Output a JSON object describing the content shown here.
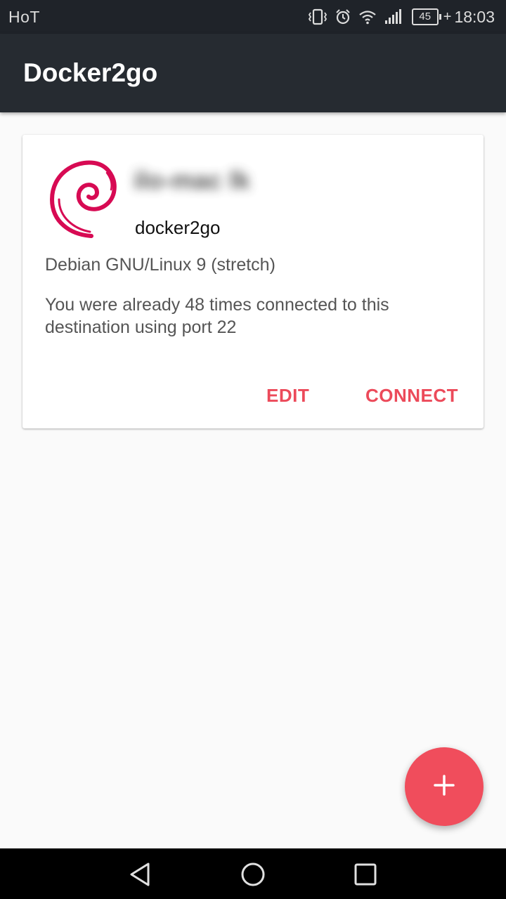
{
  "status_bar": {
    "carrier": "HoT",
    "battery_level": "45",
    "battery_charging": "+",
    "time": "18:03",
    "icons": [
      "vibrate-icon",
      "alarm-icon",
      "wifi-icon",
      "signal-icon",
      "battery-icon"
    ]
  },
  "app_bar": {
    "title": "Docker2go"
  },
  "host_card": {
    "logo_icon": "debian-swirl-icon",
    "host_name": "ilo-mac lk",
    "user": "docker2go",
    "os": "Debian GNU/Linux 9 (stretch)",
    "connection_info": "You were already 48 times connected to this destination using port 22",
    "edit_label": "EDIT",
    "connect_label": "CONNECT"
  },
  "fab": {
    "icon": "plus-icon"
  },
  "colors": {
    "accent": "#ec4a5a",
    "fab": "#f04d5c",
    "app_bar": "#262b31",
    "status_bar": "#1f2329",
    "debian_red": "#d70a53"
  },
  "nav_bar": {
    "buttons": [
      "back-icon",
      "home-icon",
      "recent-apps-icon"
    ]
  }
}
